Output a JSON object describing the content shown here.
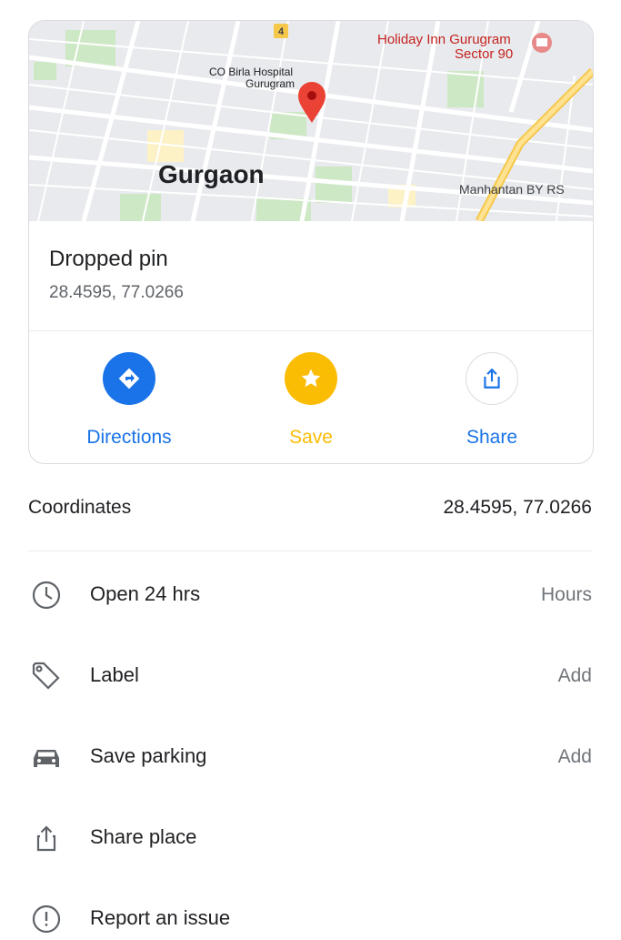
{
  "map": {
    "city_label": "Gurgaon",
    "hospital_label_1": "CO Birla Hospital",
    "hospital_label_2": "Gurugram",
    "hotel_label_1": "Holiday Inn Gurugram",
    "hotel_label_2": "Sector 90",
    "area_label": "Manhantan BY RS",
    "road_badge": "4"
  },
  "place": {
    "title": "Dropped pin",
    "coords": "28.4595, 77.0266"
  },
  "actions": [
    {
      "label": "Directions",
      "color": "#1a73e8"
    },
    {
      "label": "Save",
      "color": "#fbbc04"
    },
    {
      "label": "Share",
      "color": "#1a73e8"
    }
  ],
  "details": {
    "coords_label": "Coordinates",
    "coords_value": "28.4595, 77.0266"
  },
  "rows": [
    {
      "icon": "clock-icon",
      "label": "Open 24 hrs",
      "action": "Hours"
    },
    {
      "icon": "tag-icon",
      "label": "Label",
      "action": "Add"
    },
    {
      "icon": "car-icon",
      "label": "Save parking",
      "action": "Add"
    },
    {
      "icon": "share-icon",
      "label": "Share place",
      "action": ""
    },
    {
      "icon": "alert-icon",
      "label": "Report an issue",
      "action": ""
    }
  ]
}
